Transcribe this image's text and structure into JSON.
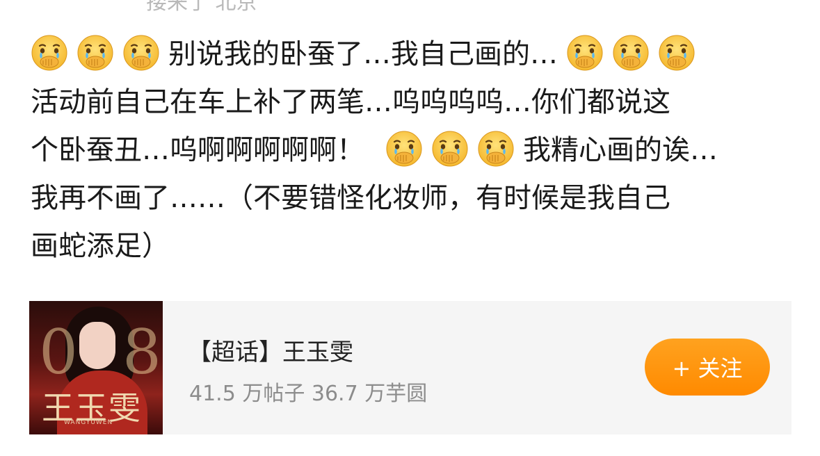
{
  "meta": {
    "top_text": "搂来了 北京"
  },
  "post": {
    "lines": [
      {
        "before_emojis": 3,
        "text": "别说我的卧蚕了…我自己画的…",
        "after_emojis": 3
      },
      {
        "before_emojis": 0,
        "text": "活动前自己在车上补了两笔…呜呜呜呜…你们都说这",
        "after_emojis": 0
      },
      {
        "before_emojis": 0,
        "text_a": "个卧蚕丑…呜啊啊啊啊啊！",
        "mid_emojis": 3,
        "text_b": "我精心画的诶…"
      },
      {
        "before_emojis": 0,
        "text": "我再不画了……（不要错怪化妆师，有时候是我自己",
        "after_emojis": 0
      },
      {
        "before_emojis": 0,
        "text": "画蛇添足）",
        "after_emojis": 0
      }
    ],
    "emoji_name": "crying-covering-mouth-emoji"
  },
  "topic_card": {
    "title": "【超话】王玉雯",
    "stats": "41.5 万帖子 36.7 万芋圆",
    "follow_label": "+ 关注",
    "accent_color": "#ff9500",
    "cover": {
      "name_text": "王玉雯",
      "number_text_a": "0",
      "number_text_b": "8",
      "sub_text": "WANGYUWEN"
    }
  }
}
